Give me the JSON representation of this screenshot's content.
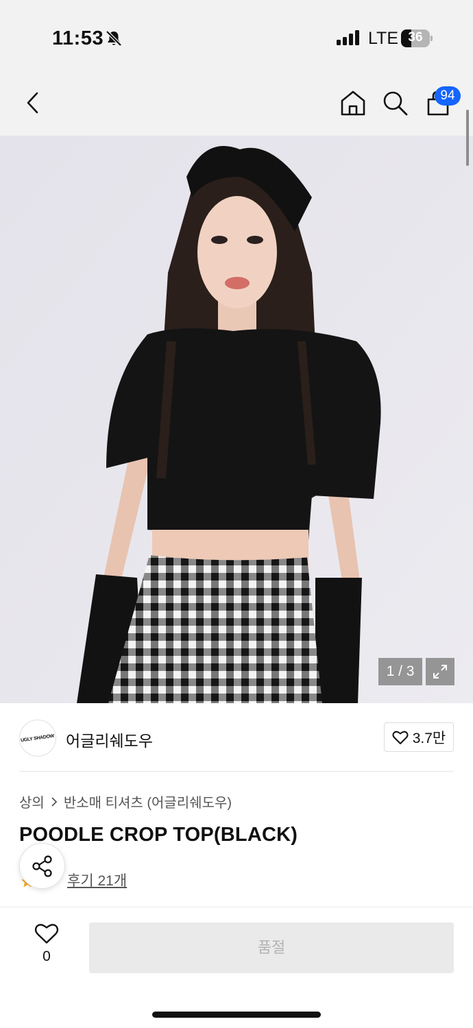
{
  "status_bar": {
    "time": "11:53",
    "network": "LTE",
    "battery_level": "36",
    "battery_fraction": 0.36,
    "icons": [
      "bell-slash-icon",
      "signal-icon",
      "battery-icon"
    ]
  },
  "header": {
    "icons": [
      "back-icon",
      "home-icon",
      "search-icon",
      "cart-icon"
    ],
    "cart_count": "94"
  },
  "gallery": {
    "counter": "1 / 3",
    "current": 1,
    "total": 3
  },
  "brand": {
    "logo_text": "UGLY SHADOW",
    "name": "어글리쉐도우",
    "likes": "3.7만"
  },
  "product": {
    "breadcrumb": [
      "상의",
      "반소매 티셔츠 (어글리쉐도우)"
    ],
    "title": "POODLE CROP TOP(BLACK)",
    "review_link": "후기 21개"
  },
  "bottom_bar": {
    "favorite_count": "0",
    "buy_label": "품절"
  },
  "colors": {
    "accent_badge": "#1565ff",
    "header_bg": "#f2f2f2",
    "soldout_bg": "#eaeaea",
    "soldout_text": "#b3b3b3"
  }
}
